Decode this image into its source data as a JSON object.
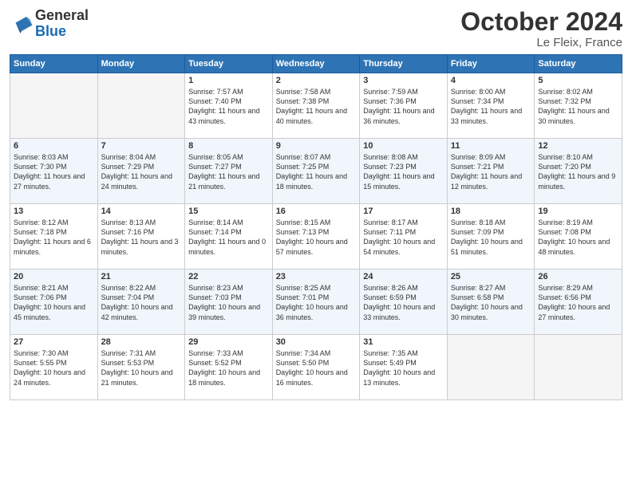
{
  "header": {
    "logo_line1": "General",
    "logo_line2": "Blue",
    "month": "October 2024",
    "location": "Le Fleix, France"
  },
  "weekdays": [
    "Sunday",
    "Monday",
    "Tuesday",
    "Wednesday",
    "Thursday",
    "Friday",
    "Saturday"
  ],
  "weeks": [
    [
      {
        "day": "",
        "info": ""
      },
      {
        "day": "",
        "info": ""
      },
      {
        "day": "1",
        "info": "Sunrise: 7:57 AM\nSunset: 7:40 PM\nDaylight: 11 hours and 43 minutes."
      },
      {
        "day": "2",
        "info": "Sunrise: 7:58 AM\nSunset: 7:38 PM\nDaylight: 11 hours and 40 minutes."
      },
      {
        "day": "3",
        "info": "Sunrise: 7:59 AM\nSunset: 7:36 PM\nDaylight: 11 hours and 36 minutes."
      },
      {
        "day": "4",
        "info": "Sunrise: 8:00 AM\nSunset: 7:34 PM\nDaylight: 11 hours and 33 minutes."
      },
      {
        "day": "5",
        "info": "Sunrise: 8:02 AM\nSunset: 7:32 PM\nDaylight: 11 hours and 30 minutes."
      }
    ],
    [
      {
        "day": "6",
        "info": "Sunrise: 8:03 AM\nSunset: 7:30 PM\nDaylight: 11 hours and 27 minutes."
      },
      {
        "day": "7",
        "info": "Sunrise: 8:04 AM\nSunset: 7:29 PM\nDaylight: 11 hours and 24 minutes."
      },
      {
        "day": "8",
        "info": "Sunrise: 8:05 AM\nSunset: 7:27 PM\nDaylight: 11 hours and 21 minutes."
      },
      {
        "day": "9",
        "info": "Sunrise: 8:07 AM\nSunset: 7:25 PM\nDaylight: 11 hours and 18 minutes."
      },
      {
        "day": "10",
        "info": "Sunrise: 8:08 AM\nSunset: 7:23 PM\nDaylight: 11 hours and 15 minutes."
      },
      {
        "day": "11",
        "info": "Sunrise: 8:09 AM\nSunset: 7:21 PM\nDaylight: 11 hours and 12 minutes."
      },
      {
        "day": "12",
        "info": "Sunrise: 8:10 AM\nSunset: 7:20 PM\nDaylight: 11 hours and 9 minutes."
      }
    ],
    [
      {
        "day": "13",
        "info": "Sunrise: 8:12 AM\nSunset: 7:18 PM\nDaylight: 11 hours and 6 minutes."
      },
      {
        "day": "14",
        "info": "Sunrise: 8:13 AM\nSunset: 7:16 PM\nDaylight: 11 hours and 3 minutes."
      },
      {
        "day": "15",
        "info": "Sunrise: 8:14 AM\nSunset: 7:14 PM\nDaylight: 11 hours and 0 minutes."
      },
      {
        "day": "16",
        "info": "Sunrise: 8:15 AM\nSunset: 7:13 PM\nDaylight: 10 hours and 57 minutes."
      },
      {
        "day": "17",
        "info": "Sunrise: 8:17 AM\nSunset: 7:11 PM\nDaylight: 10 hours and 54 minutes."
      },
      {
        "day": "18",
        "info": "Sunrise: 8:18 AM\nSunset: 7:09 PM\nDaylight: 10 hours and 51 minutes."
      },
      {
        "day": "19",
        "info": "Sunrise: 8:19 AM\nSunset: 7:08 PM\nDaylight: 10 hours and 48 minutes."
      }
    ],
    [
      {
        "day": "20",
        "info": "Sunrise: 8:21 AM\nSunset: 7:06 PM\nDaylight: 10 hours and 45 minutes."
      },
      {
        "day": "21",
        "info": "Sunrise: 8:22 AM\nSunset: 7:04 PM\nDaylight: 10 hours and 42 minutes."
      },
      {
        "day": "22",
        "info": "Sunrise: 8:23 AM\nSunset: 7:03 PM\nDaylight: 10 hours and 39 minutes."
      },
      {
        "day": "23",
        "info": "Sunrise: 8:25 AM\nSunset: 7:01 PM\nDaylight: 10 hours and 36 minutes."
      },
      {
        "day": "24",
        "info": "Sunrise: 8:26 AM\nSunset: 6:59 PM\nDaylight: 10 hours and 33 minutes."
      },
      {
        "day": "25",
        "info": "Sunrise: 8:27 AM\nSunset: 6:58 PM\nDaylight: 10 hours and 30 minutes."
      },
      {
        "day": "26",
        "info": "Sunrise: 8:29 AM\nSunset: 6:56 PM\nDaylight: 10 hours and 27 minutes."
      }
    ],
    [
      {
        "day": "27",
        "info": "Sunrise: 7:30 AM\nSunset: 5:55 PM\nDaylight: 10 hours and 24 minutes."
      },
      {
        "day": "28",
        "info": "Sunrise: 7:31 AM\nSunset: 5:53 PM\nDaylight: 10 hours and 21 minutes."
      },
      {
        "day": "29",
        "info": "Sunrise: 7:33 AM\nSunset: 5:52 PM\nDaylight: 10 hours and 18 minutes."
      },
      {
        "day": "30",
        "info": "Sunrise: 7:34 AM\nSunset: 5:50 PM\nDaylight: 10 hours and 16 minutes."
      },
      {
        "day": "31",
        "info": "Sunrise: 7:35 AM\nSunset: 5:49 PM\nDaylight: 10 hours and 13 minutes."
      },
      {
        "day": "",
        "info": ""
      },
      {
        "day": "",
        "info": ""
      }
    ]
  ]
}
